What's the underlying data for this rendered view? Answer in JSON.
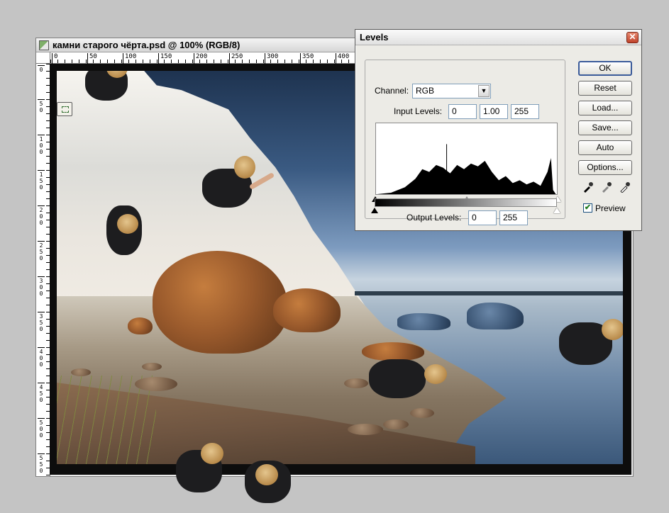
{
  "document": {
    "title": "камни старого чёрта.psd @ 100% (RGB/8)",
    "ruler_top_ticks": [
      "0",
      "50",
      "100",
      "150",
      "200",
      "250",
      "300",
      "350",
      "400"
    ],
    "ruler_left_ticks": [
      "0",
      "5 0",
      "1 0 0",
      "1 5 0",
      "2 0 0",
      "2 5 0",
      "3 0 0",
      "3 5 0",
      "4 0 0",
      "4 5 0",
      "5 0 0",
      "5 5 0"
    ]
  },
  "levels_dialog": {
    "title": "Levels",
    "channel_label": "Channel:",
    "channel_value": "RGB",
    "input_levels_label": "Input Levels:",
    "input_black": "0",
    "input_gamma": "1.00",
    "input_white": "255",
    "output_levels_label": "Output Levels:",
    "output_black": "0",
    "output_white": "255",
    "buttons": {
      "ok": "OK",
      "reset": "Reset",
      "load": "Load...",
      "save": "Save...",
      "auto": "Auto",
      "options": "Options..."
    },
    "preview_label": "Preview",
    "preview_checked": true,
    "eyedroppers": [
      "black-eyedropper-icon",
      "gray-eyedropper-icon",
      "white-eyedropper-icon"
    ]
  },
  "colors": {
    "dialog_bg": "#ecebe6",
    "close_button": "#c0432b",
    "default_button_border": "#3b5b9a"
  }
}
